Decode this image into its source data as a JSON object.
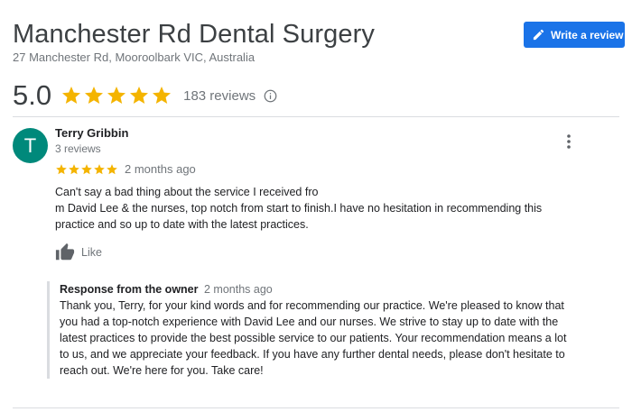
{
  "business": {
    "name": "Manchester Rd Dental Surgery",
    "address": "27 Manchester Rd, Mooroolbark VIC, Australia"
  },
  "write_review_label": "Write a review",
  "summary": {
    "rating": "5.0",
    "stars": 5,
    "review_count": "183 reviews"
  },
  "review": {
    "avatar_letter": "T",
    "reviewer": "Terry Gribbin",
    "reviewer_meta": "3 reviews",
    "stars": 5,
    "date": "2 months ago",
    "text_lines": [
      "Can't say a bad thing about the service I received fro",
      "m David Lee & the nurses,  top notch from start to finish.I have no hesitation in recommending this",
      "practice and so up to date with the latest practices."
    ],
    "like_label": "Like"
  },
  "owner_response": {
    "label": "Response from the owner",
    "date": "2 months ago",
    "text_lines": [
      "Thank you, Terry, for your kind words and for recommending our practice. We're pleased to know that",
      "you had a top-notch experience with David Lee and our nurses. We strive to stay up to date with the",
      "latest practices to provide the best possible service to our patients. Your recommendation means a lot",
      "to us, and we appreciate your feedback. If you have any further dental needs, please don't hesitate to",
      "reach out. We're here for you. Take care!"
    ]
  },
  "colors": {
    "star": "#f4b400",
    "accent": "#1a73e8",
    "avatar": "#00897b"
  },
  "icons": [
    "edit-pencil-icon",
    "star-icon",
    "info-icon",
    "more-vertical-icon",
    "thumbs-up-icon"
  ]
}
